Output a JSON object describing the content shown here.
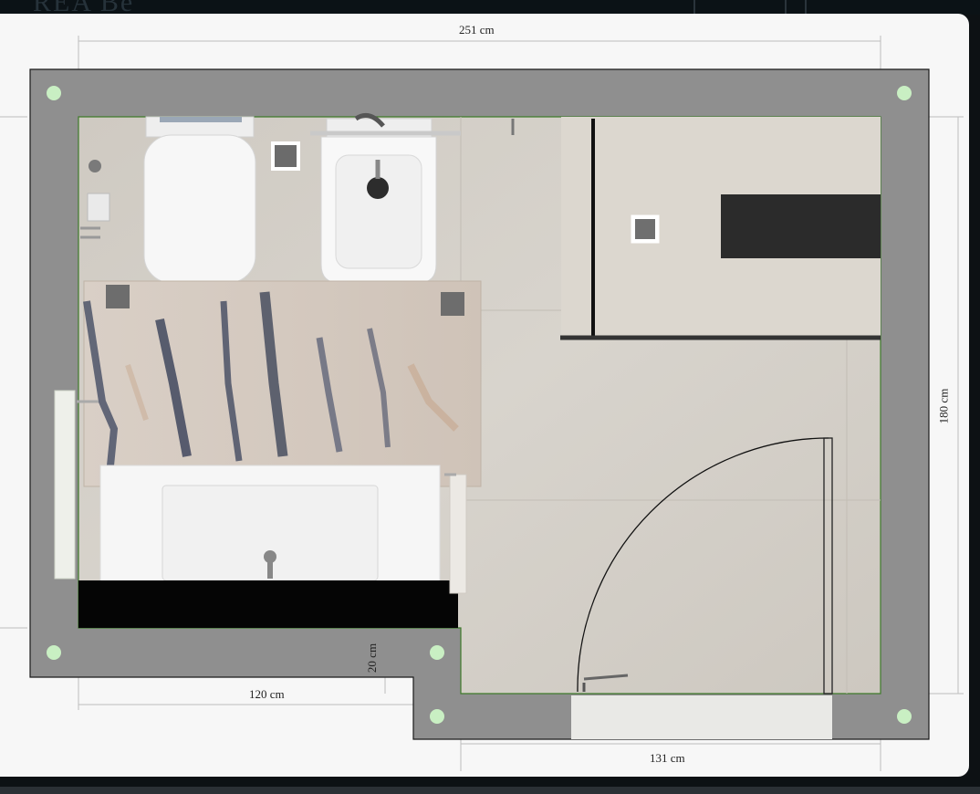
{
  "header": {
    "logo_text": "REA Be"
  },
  "floorplan": {
    "dimensions": {
      "top_width": "251 cm",
      "right_height": "180 cm",
      "bottom_left_width": "120 cm",
      "step_height": "20 cm",
      "bottom_right_width": "131 cm"
    },
    "colors": {
      "wall": "#8f8f8f",
      "wall_outline": "#1a1a1a",
      "inner_outline": "#3f7a2a",
      "floor": "#d3cfc8",
      "shower_tray": "#d9d4cc",
      "corner_marker": "#c9efc3",
      "fixture_white": "#f4f4f4",
      "glass_black": "#111111"
    },
    "fixtures": [
      "toilet",
      "bidet",
      "rug",
      "vanity-sink",
      "shower",
      "door-swing",
      "towel-rail",
      "radiator"
    ]
  }
}
